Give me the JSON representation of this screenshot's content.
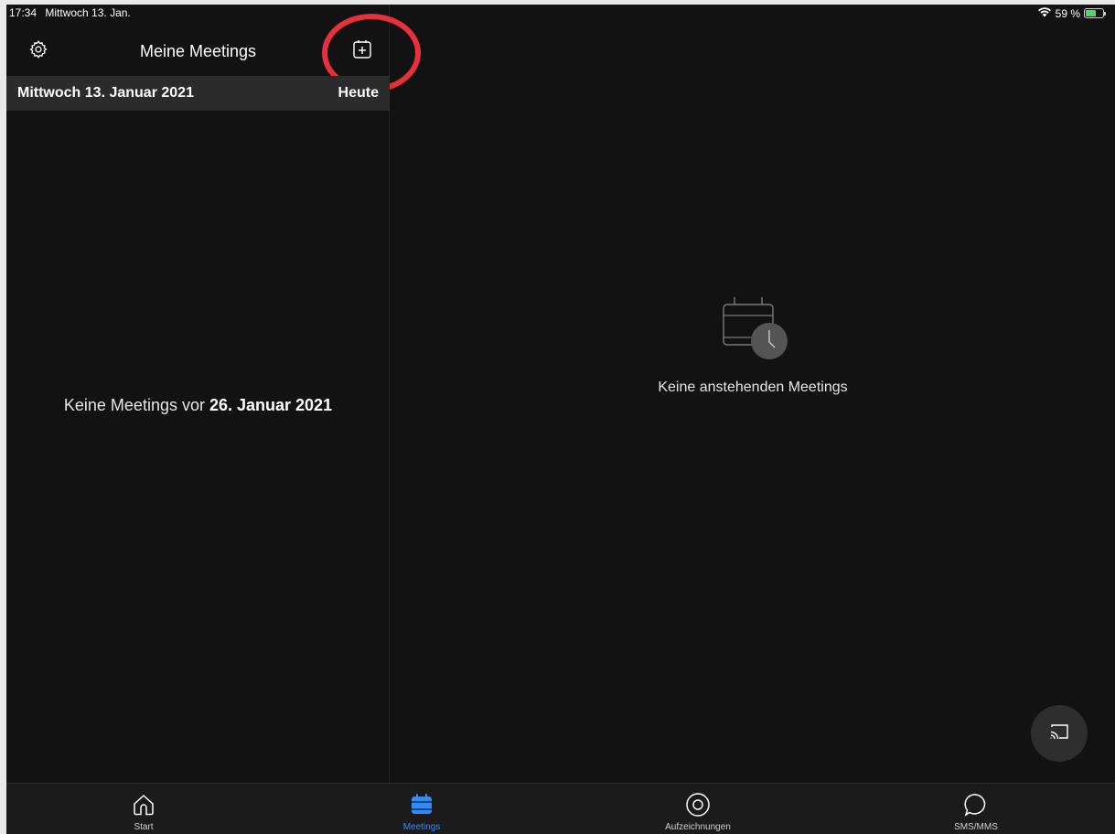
{
  "status_bar": {
    "time": "17:34",
    "date": "Mittwoch 13. Jan.",
    "battery": "59 %",
    "battery_level": 0.59,
    "wifi_icon": "wifi-icon",
    "battery_icon": "battery-charging-icon"
  },
  "left_pane": {
    "title": "Meine Meetings",
    "settings_icon": "gear-icon",
    "schedule_icon": "calendar-plus-icon",
    "date_row": {
      "date": "Mittwoch 13. Januar 2021",
      "today_label": "Heute"
    },
    "empty_message": {
      "prefix": "Keine Meetings vor ",
      "date": "26. Januar 2021"
    }
  },
  "right_pane": {
    "empty_icon": "calendar-clock-icon",
    "empty_text": "Keine anstehenden Meetings",
    "cast_icon": "screen-share-icon"
  },
  "tab_bar": {
    "tabs": [
      {
        "label": "Start",
        "icon": "home-icon",
        "active": false
      },
      {
        "label": "Meetings",
        "icon": "calendar-icon",
        "active": true
      },
      {
        "label": "Aufzeichnungen",
        "icon": "record-icon",
        "active": false
      },
      {
        "label": "SMS/MMS",
        "icon": "chat-bubble-icon",
        "active": false
      }
    ]
  },
  "colors": {
    "background": "#121212",
    "accent": "#2d8cff",
    "highlight_ring": "#e5313b",
    "battery_green": "#4cd964"
  }
}
